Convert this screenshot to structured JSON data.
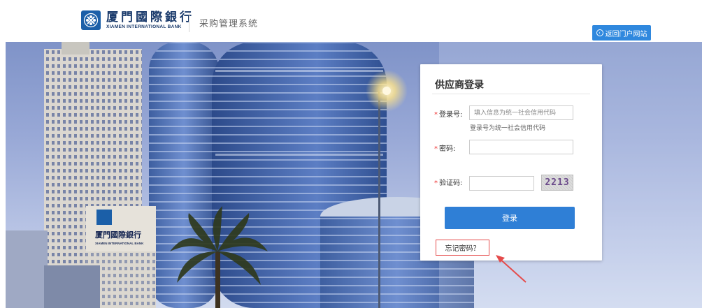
{
  "header": {
    "bank_name_cn": "厦門國際銀行",
    "bank_name_en": "XIAMEN INTERNATIONAL BANK",
    "system_title": "采购管理系统",
    "back_portal_label": "返回门户网站"
  },
  "login_card": {
    "title": "供应商登录",
    "required_mark": "*",
    "username_label": "登录号:",
    "username_placeholder": "填入信息为统一社会信用代码",
    "username_hint": "登录号为统一社会信用代码",
    "password_label": "密码:",
    "captcha_label": "验证码:",
    "captcha_text": "2213",
    "login_button": "登录",
    "forgot_password": "忘记密码？"
  },
  "banner": {
    "building_sign_cn": "厦門國際銀行",
    "building_sign_en": "XIAMEN INTERNATIONAL BANK"
  },
  "colors": {
    "brand_blue": "#1b5fa8",
    "button_blue": "#2f7fd6",
    "highlight_red": "#e54b4b"
  }
}
